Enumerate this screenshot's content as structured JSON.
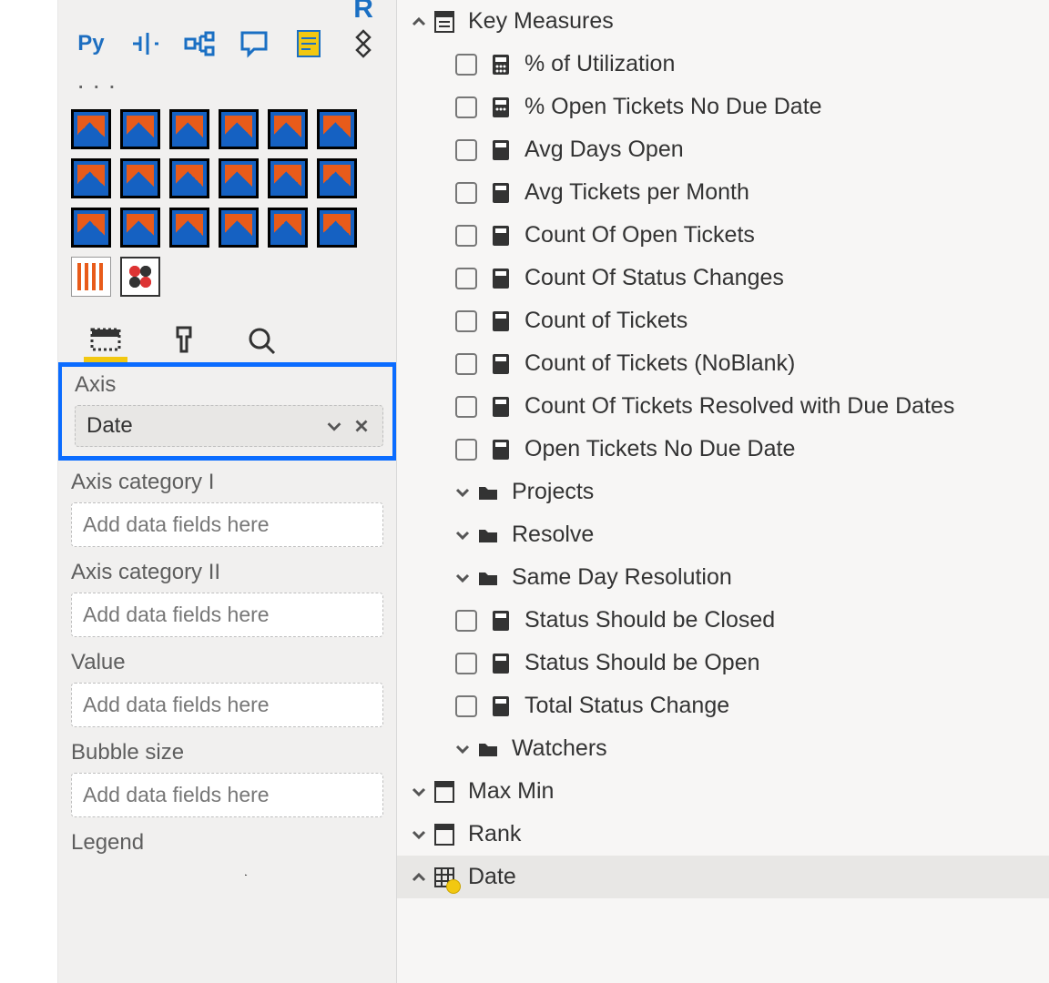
{
  "toolbar": {
    "py_label": "Py",
    "ellipsis": "· · ·"
  },
  "wells": {
    "axis": {
      "label": "Axis",
      "value": "Date"
    },
    "cat1": {
      "label": "Axis category I",
      "placeholder": "Add data fields here"
    },
    "cat2": {
      "label": "Axis category II",
      "placeholder": "Add data fields here"
    },
    "value": {
      "label": "Value",
      "placeholder": "Add data fields here"
    },
    "bubble": {
      "label": "Bubble size",
      "placeholder": "Add data fields here"
    },
    "legend": {
      "label": "Legend"
    }
  },
  "fields": {
    "key_measures": {
      "label": "Key Measures"
    },
    "measures": [
      "% of Utilization",
      "% Open Tickets No Due Date",
      "Avg Days Open",
      "Avg Tickets per Month",
      "Count Of Open Tickets",
      "Count Of Status Changes",
      "Count of Tickets",
      "Count of Tickets (NoBlank)",
      "Count Of Tickets Resolved with Due Dates",
      "Open Tickets No Due Date"
    ],
    "folders": [
      "Projects",
      "Resolve",
      "Same Day Resolution"
    ],
    "status_measures": [
      "Status Should be Closed",
      "Status Should be Open",
      "Total Status Change"
    ],
    "watchers": "Watchers",
    "tables": [
      "Max Min",
      "Rank"
    ],
    "date_table": "Date"
  }
}
